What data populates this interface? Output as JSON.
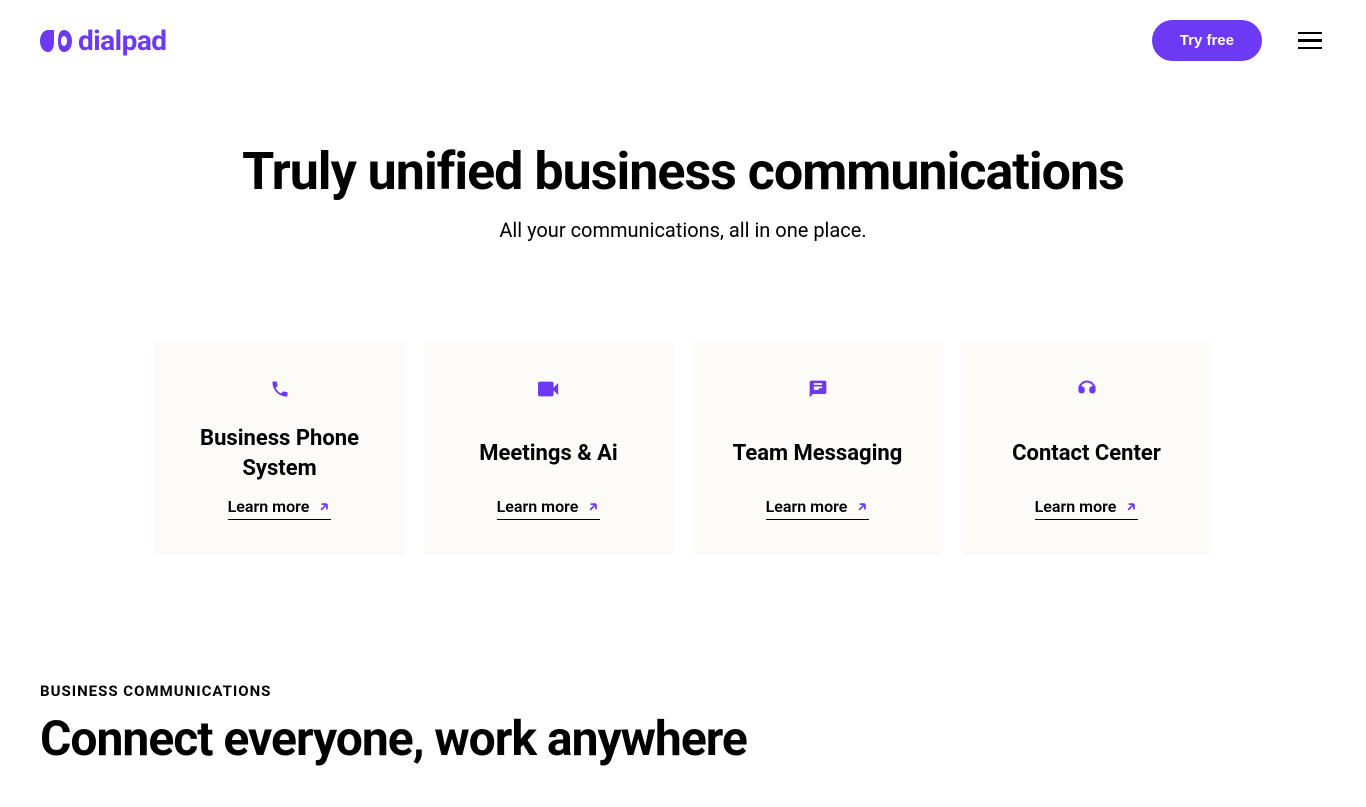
{
  "header": {
    "logo_text": "dialpad",
    "try_free_label": "Try free"
  },
  "hero": {
    "title": "Truly unified business communications",
    "subtitle": "All your communications, all in one place."
  },
  "cards": [
    {
      "title": "Business Phone System",
      "link_label": "Learn more",
      "icon": "phone"
    },
    {
      "title": "Meetings & Ai",
      "link_label": "Learn more",
      "icon": "video"
    },
    {
      "title": "Team Messaging",
      "link_label": "Learn more",
      "icon": "chat"
    },
    {
      "title": "Contact Center",
      "link_label": "Learn more",
      "icon": "headphones"
    }
  ],
  "bottom_section": {
    "eyebrow": "BUSINESS COMMUNICATIONS",
    "heading": "Connect everyone, work anywhere"
  },
  "colors": {
    "primary": "#6C39F4"
  }
}
